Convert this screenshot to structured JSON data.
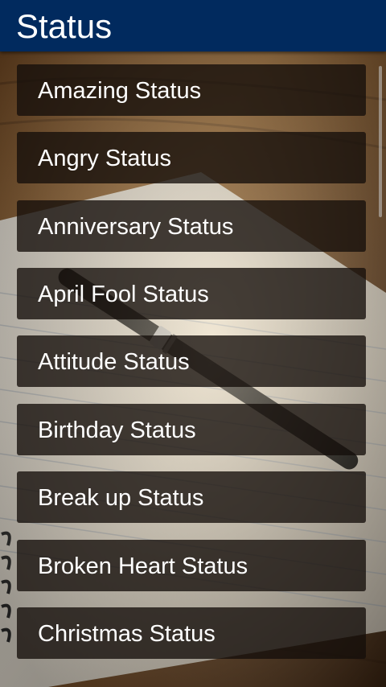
{
  "app_bar": {
    "title": "Status",
    "background_color": "#012a5e"
  },
  "list": {
    "items": [
      {
        "label": "Amazing Status"
      },
      {
        "label": "Angry Status"
      },
      {
        "label": "Anniversary Status"
      },
      {
        "label": "April Fool Status"
      },
      {
        "label": "Attitude Status"
      },
      {
        "label": "Birthday Status"
      },
      {
        "label": "Break up Status"
      },
      {
        "label": "Broken Heart Status"
      },
      {
        "label": "Christmas Status"
      }
    ],
    "item_background": "rgba(20,14,10,0.78)",
    "text_color": "#ffffff"
  },
  "background_image": {
    "subject": "notebook-and-pen-on-wooden-desk"
  }
}
